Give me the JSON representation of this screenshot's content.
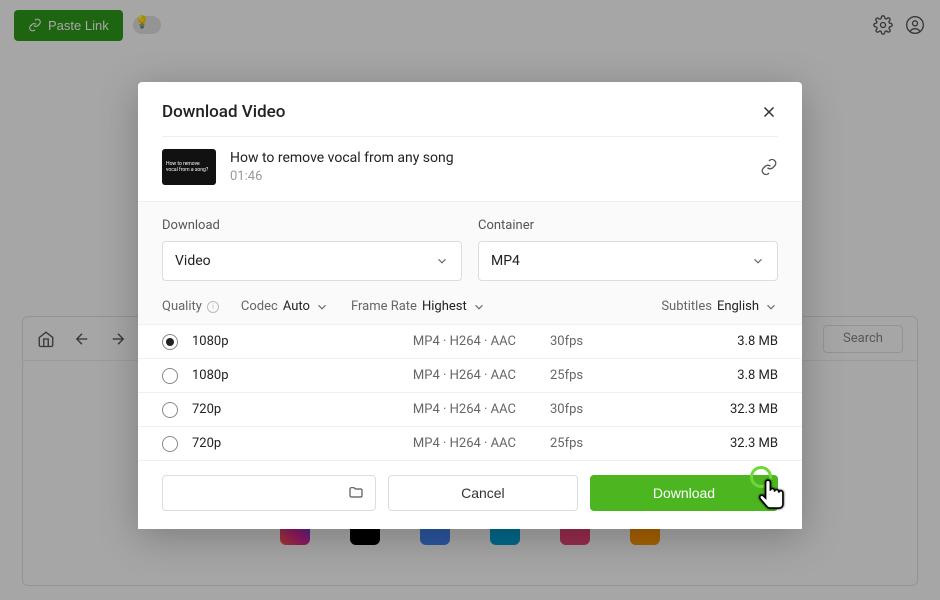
{
  "topbar": {
    "paste_label": "Paste Link"
  },
  "browser": {
    "search_label": "Search"
  },
  "modal": {
    "title": "Download Video",
    "video": {
      "thumb_text": "How to remove vocal from a song?",
      "title": "How to remove vocal from any song",
      "duration": "01:46"
    },
    "download_label": "Download",
    "download_value": "Video",
    "container_label": "Container",
    "container_value": "MP4",
    "quality_label": "Quality",
    "codec_label": "Codec",
    "codec_value": "Auto",
    "framerate_label": "Frame Rate",
    "framerate_value": "Highest",
    "subtitles_label": "Subtitles",
    "subtitles_value": "English",
    "options": [
      {
        "res": "1080p",
        "codec": "MP4 · H264 · AAC",
        "fps": "30fps",
        "size": "3.8 MB",
        "selected": true
      },
      {
        "res": "1080p",
        "codec": "MP4 · H264 · AAC",
        "fps": "25fps",
        "size": "3.8 MB",
        "selected": false
      },
      {
        "res": "720p",
        "codec": "MP4 · H264 · AAC",
        "fps": "30fps",
        "size": "32.3 MB",
        "selected": false
      },
      {
        "res": "720p",
        "codec": "MP4 · H264 · AAC",
        "fps": "25fps",
        "size": "32.3 MB",
        "selected": false
      }
    ],
    "cancel_label": "Cancel",
    "download_btn_label": "Download"
  }
}
